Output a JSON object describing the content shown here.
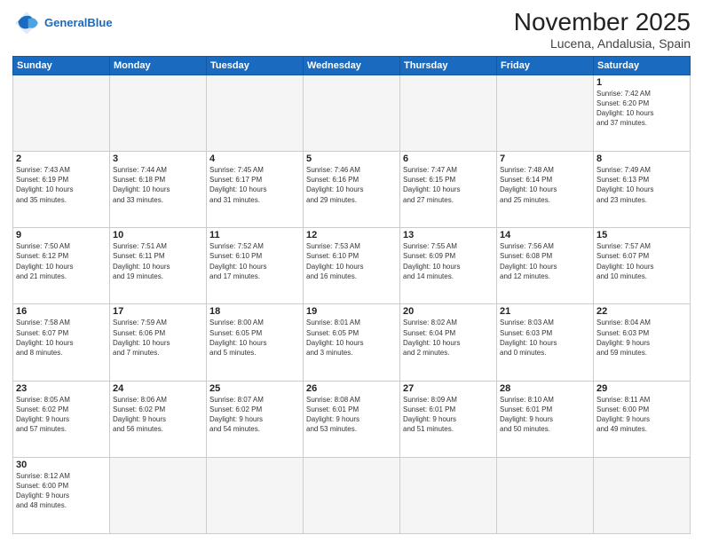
{
  "header": {
    "logo_general": "General",
    "logo_blue": "Blue",
    "title": "November 2025",
    "subtitle": "Lucena, Andalusia, Spain"
  },
  "weekdays": [
    "Sunday",
    "Monday",
    "Tuesday",
    "Wednesday",
    "Thursday",
    "Friday",
    "Saturday"
  ],
  "weeks": [
    [
      {
        "day": "",
        "info": ""
      },
      {
        "day": "",
        "info": ""
      },
      {
        "day": "",
        "info": ""
      },
      {
        "day": "",
        "info": ""
      },
      {
        "day": "",
        "info": ""
      },
      {
        "day": "",
        "info": ""
      },
      {
        "day": "1",
        "info": "Sunrise: 7:42 AM\nSunset: 6:20 PM\nDaylight: 10 hours\nand 37 minutes."
      }
    ],
    [
      {
        "day": "2",
        "info": "Sunrise: 7:43 AM\nSunset: 6:19 PM\nDaylight: 10 hours\nand 35 minutes."
      },
      {
        "day": "3",
        "info": "Sunrise: 7:44 AM\nSunset: 6:18 PM\nDaylight: 10 hours\nand 33 minutes."
      },
      {
        "day": "4",
        "info": "Sunrise: 7:45 AM\nSunset: 6:17 PM\nDaylight: 10 hours\nand 31 minutes."
      },
      {
        "day": "5",
        "info": "Sunrise: 7:46 AM\nSunset: 6:16 PM\nDaylight: 10 hours\nand 29 minutes."
      },
      {
        "day": "6",
        "info": "Sunrise: 7:47 AM\nSunset: 6:15 PM\nDaylight: 10 hours\nand 27 minutes."
      },
      {
        "day": "7",
        "info": "Sunrise: 7:48 AM\nSunset: 6:14 PM\nDaylight: 10 hours\nand 25 minutes."
      },
      {
        "day": "8",
        "info": "Sunrise: 7:49 AM\nSunset: 6:13 PM\nDaylight: 10 hours\nand 23 minutes."
      }
    ],
    [
      {
        "day": "9",
        "info": "Sunrise: 7:50 AM\nSunset: 6:12 PM\nDaylight: 10 hours\nand 21 minutes."
      },
      {
        "day": "10",
        "info": "Sunrise: 7:51 AM\nSunset: 6:11 PM\nDaylight: 10 hours\nand 19 minutes."
      },
      {
        "day": "11",
        "info": "Sunrise: 7:52 AM\nSunset: 6:10 PM\nDaylight: 10 hours\nand 17 minutes."
      },
      {
        "day": "12",
        "info": "Sunrise: 7:53 AM\nSunset: 6:10 PM\nDaylight: 10 hours\nand 16 minutes."
      },
      {
        "day": "13",
        "info": "Sunrise: 7:55 AM\nSunset: 6:09 PM\nDaylight: 10 hours\nand 14 minutes."
      },
      {
        "day": "14",
        "info": "Sunrise: 7:56 AM\nSunset: 6:08 PM\nDaylight: 10 hours\nand 12 minutes."
      },
      {
        "day": "15",
        "info": "Sunrise: 7:57 AM\nSunset: 6:07 PM\nDaylight: 10 hours\nand 10 minutes."
      }
    ],
    [
      {
        "day": "16",
        "info": "Sunrise: 7:58 AM\nSunset: 6:07 PM\nDaylight: 10 hours\nand 8 minutes."
      },
      {
        "day": "17",
        "info": "Sunrise: 7:59 AM\nSunset: 6:06 PM\nDaylight: 10 hours\nand 7 minutes."
      },
      {
        "day": "18",
        "info": "Sunrise: 8:00 AM\nSunset: 6:05 PM\nDaylight: 10 hours\nand 5 minutes."
      },
      {
        "day": "19",
        "info": "Sunrise: 8:01 AM\nSunset: 6:05 PM\nDaylight: 10 hours\nand 3 minutes."
      },
      {
        "day": "20",
        "info": "Sunrise: 8:02 AM\nSunset: 6:04 PM\nDaylight: 10 hours\nand 2 minutes."
      },
      {
        "day": "21",
        "info": "Sunrise: 8:03 AM\nSunset: 6:03 PM\nDaylight: 10 hours\nand 0 minutes."
      },
      {
        "day": "22",
        "info": "Sunrise: 8:04 AM\nSunset: 6:03 PM\nDaylight: 9 hours\nand 59 minutes."
      }
    ],
    [
      {
        "day": "23",
        "info": "Sunrise: 8:05 AM\nSunset: 6:02 PM\nDaylight: 9 hours\nand 57 minutes."
      },
      {
        "day": "24",
        "info": "Sunrise: 8:06 AM\nSunset: 6:02 PM\nDaylight: 9 hours\nand 56 minutes."
      },
      {
        "day": "25",
        "info": "Sunrise: 8:07 AM\nSunset: 6:02 PM\nDaylight: 9 hours\nand 54 minutes."
      },
      {
        "day": "26",
        "info": "Sunrise: 8:08 AM\nSunset: 6:01 PM\nDaylight: 9 hours\nand 53 minutes."
      },
      {
        "day": "27",
        "info": "Sunrise: 8:09 AM\nSunset: 6:01 PM\nDaylight: 9 hours\nand 51 minutes."
      },
      {
        "day": "28",
        "info": "Sunrise: 8:10 AM\nSunset: 6:01 PM\nDaylight: 9 hours\nand 50 minutes."
      },
      {
        "day": "29",
        "info": "Sunrise: 8:11 AM\nSunset: 6:00 PM\nDaylight: 9 hours\nand 49 minutes."
      }
    ],
    [
      {
        "day": "30",
        "info": "Sunrise: 8:12 AM\nSunset: 6:00 PM\nDaylight: 9 hours\nand 48 minutes."
      },
      {
        "day": "",
        "info": ""
      },
      {
        "day": "",
        "info": ""
      },
      {
        "day": "",
        "info": ""
      },
      {
        "day": "",
        "info": ""
      },
      {
        "day": "",
        "info": ""
      },
      {
        "day": "",
        "info": ""
      }
    ]
  ]
}
